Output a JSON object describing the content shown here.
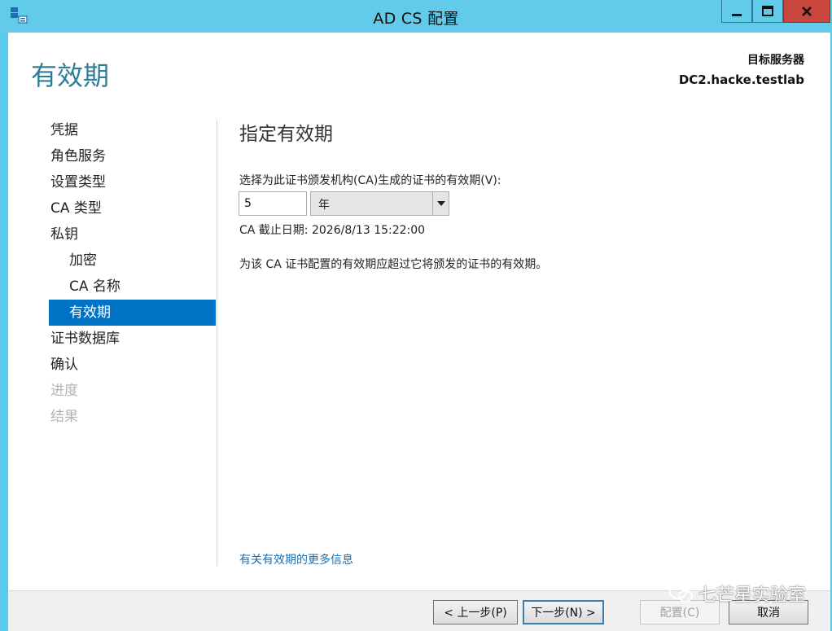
{
  "window": {
    "title": "AD CS 配置",
    "accent_color": "#63cbea",
    "close_color": "#c9463d"
  },
  "header": {
    "page_heading": "有效期",
    "target_label": "目标服务器",
    "target_value": "DC2.hacke.testlab"
  },
  "nav": {
    "items": [
      {
        "label": "凭据"
      },
      {
        "label": "角色服务"
      },
      {
        "label": "设置类型"
      },
      {
        "label": "CA 类型"
      },
      {
        "label": "私钥"
      },
      {
        "label": "加密"
      },
      {
        "label": "CA 名称"
      },
      {
        "label": "有效期"
      },
      {
        "label": "证书数据库"
      },
      {
        "label": "确认"
      },
      {
        "label": "进度"
      },
      {
        "label": "结果"
      }
    ],
    "active_color": "#0072c6"
  },
  "main": {
    "section_title": "指定有效期",
    "prompt": "选择为此证书颁发机构(CA)生成的证书的有效期(V):",
    "period_value": "5",
    "period_unit": "年",
    "expiry": "CA 截止日期: 2026/8/13 15:22:00",
    "note": "为该 CA 证书配置的有效期应超过它将颁发的证书的有效期。",
    "more_info_link": "有关有效期的更多信息"
  },
  "footer": {
    "back_label": "< 上一步(P)",
    "next_label": "下一步(N) >",
    "configure_label": "配置(C)",
    "cancel_label": "取消"
  },
  "watermark": {
    "text": "七芒星实验室"
  }
}
